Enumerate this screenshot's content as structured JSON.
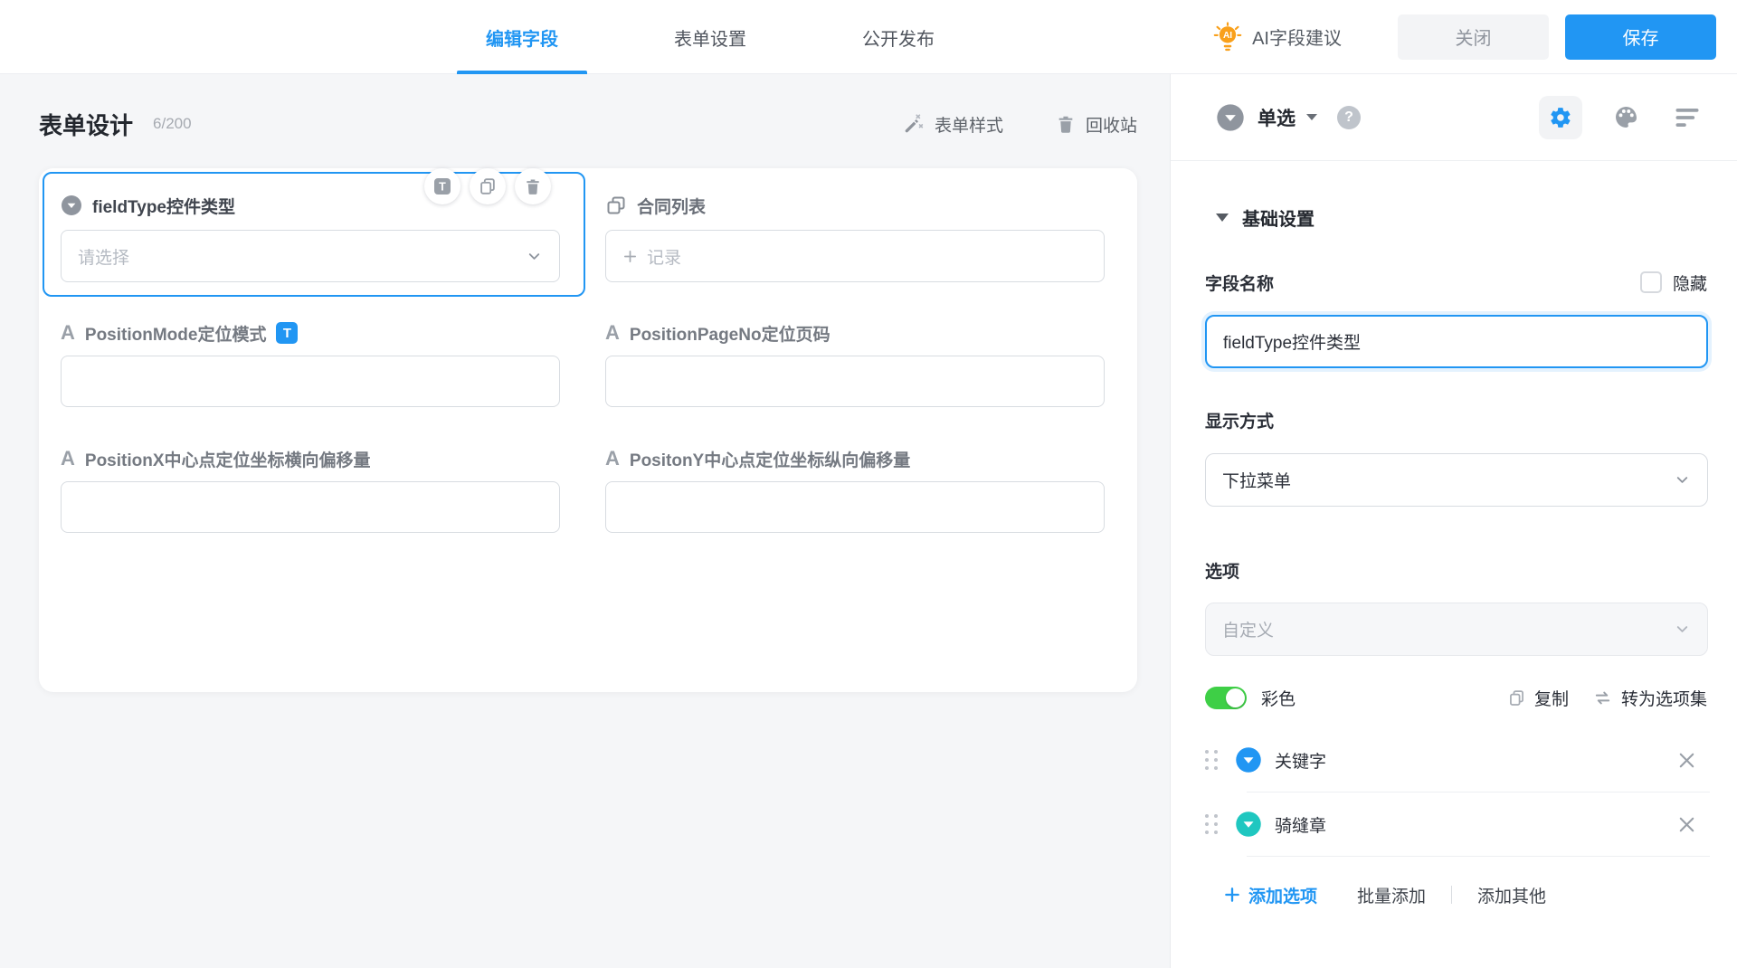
{
  "topbar": {
    "tabs": [
      {
        "label": "编辑字段",
        "active": true
      },
      {
        "label": "表单设置",
        "active": false
      },
      {
        "label": "公开发布",
        "active": false
      }
    ],
    "ai_suggest_label": "AI字段建议",
    "close_label": "关闭",
    "save_label": "保存"
  },
  "canvas": {
    "title": "表单设计",
    "field_count": "6/200",
    "form_style_label": "表单样式",
    "recycle_bin_label": "回收站",
    "fields": [
      {
        "label": "fieldType控件类型",
        "control": "select",
        "placeholder": "请选择"
      },
      {
        "label": "合同列表",
        "control": "record",
        "placeholder": "记录"
      },
      {
        "label": "PositionMode定位模式",
        "control": "text",
        "badge": "T"
      },
      {
        "label": "PositionPageNo定位页码",
        "control": "text"
      },
      {
        "label": "PositionX中心点定位坐标横向偏移量",
        "control": "text"
      },
      {
        "label": "PositonY中心点定位坐标纵向偏移量",
        "control": "text"
      }
    ]
  },
  "inspector": {
    "field_type_label": "单选",
    "basic_section_label": "基础设置",
    "field_name_label": "字段名称",
    "hide_label": "隐藏",
    "field_name_value": "fieldType控件类型",
    "display_mode_label": "显示方式",
    "display_mode_value": "下拉菜单",
    "options_label": "选项",
    "options_source_value": "自定义",
    "colorful_label": "彩色",
    "copy_label": "复制",
    "convert_label": "转为选项集",
    "options": [
      {
        "label": "关键字",
        "color": "#2196f3"
      },
      {
        "label": "骑缝章",
        "color": "#1fc7c0"
      }
    ],
    "add_option_label": "添加选项",
    "batch_add_label": "批量添加",
    "add_other_label": "添加其他"
  },
  "icons": {
    "a_glyph": "A",
    "t_glyph": "T",
    "ai_glyph": "AI",
    "help_glyph": "?"
  },
  "colors": {
    "accent_blue": "#2196f3",
    "toggle_green": "#3ecf46",
    "option_teal": "#1fc7c0",
    "ai_orange": "#f9a01b"
  }
}
